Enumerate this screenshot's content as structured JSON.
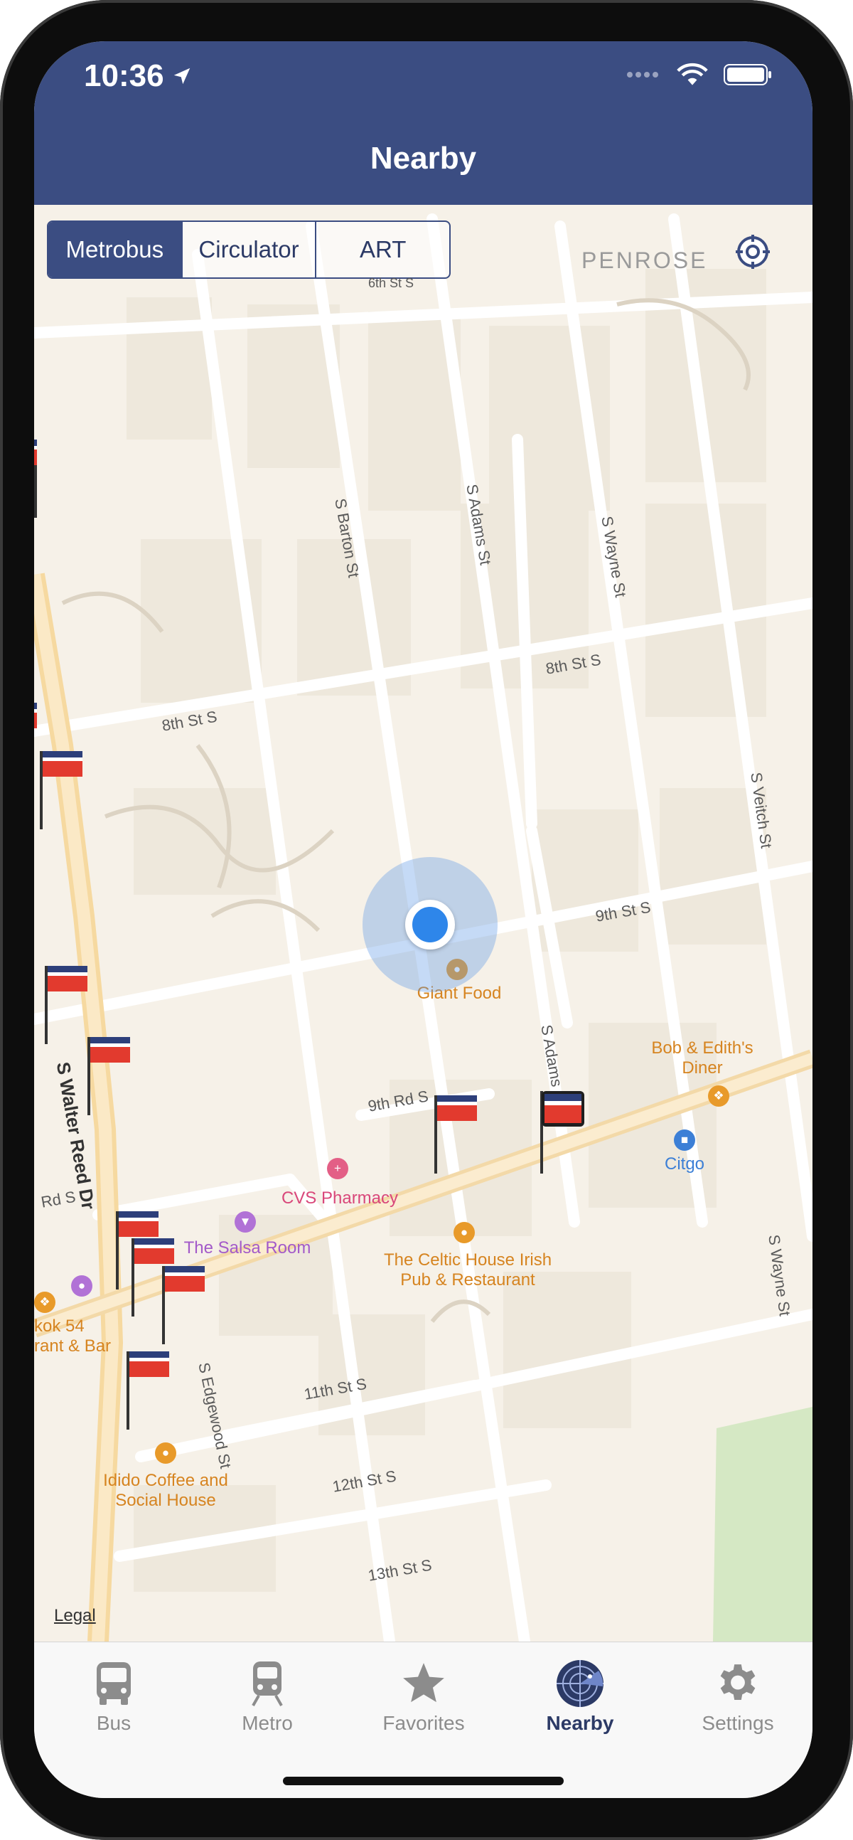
{
  "status_bar": {
    "time": "10:36"
  },
  "header": {
    "title": "Nearby"
  },
  "segments": {
    "metrobus": "Metrobus",
    "circulator": "Circulator",
    "art": "ART"
  },
  "map": {
    "neighborhood": "PENROSE",
    "legal": "Legal",
    "streets": {
      "barton": "S Barton St",
      "adams_n": "S Adams St",
      "wayne_n": "S Wayne St",
      "eighth_e": "8th St S",
      "eighth_w": "8th St S",
      "veitch": "S Veitch St",
      "ninth": "9th St S",
      "adams_s": "S Adams St",
      "walter_reed": "S Walter Reed Dr",
      "ninth_rd": "9th Rd S",
      "wayne_s": "S Wayne St",
      "edgewood": "S Edgewood St",
      "eleventh": "11th St S",
      "twelfth": "12th St S",
      "thirteenth": "13th St S",
      "rd_s": "Rd S",
      "sixth": "6th St S"
    },
    "pois": {
      "giant": "Giant Food",
      "bob": "Bob & Edith's Diner",
      "citgo": "Citgo",
      "cvs": "CVS Pharmacy",
      "salsa": "The Salsa Room",
      "celtic": "The Celtic House Irish Pub & Restaurant",
      "bangkok": "kok 54 rant & Bar",
      "idido": "Idido Coffee and Social House"
    },
    "icons": {
      "locate": "location-target-icon",
      "stop": "bus-stop-flag-icon"
    }
  },
  "tabs": [
    {
      "label": "Bus",
      "icon": "bus-icon"
    },
    {
      "label": "Metro",
      "icon": "train-icon"
    },
    {
      "label": "Favorites",
      "icon": "star-icon"
    },
    {
      "label": "Nearby",
      "icon": "radar-icon",
      "active": true
    },
    {
      "label": "Settings",
      "icon": "gear-icon"
    }
  ],
  "colors": {
    "brand": "#3b4d82",
    "map_bg": "#f6f1e8",
    "user_location": "#2e86ea",
    "inactive_tab": "#8c8c8c"
  }
}
